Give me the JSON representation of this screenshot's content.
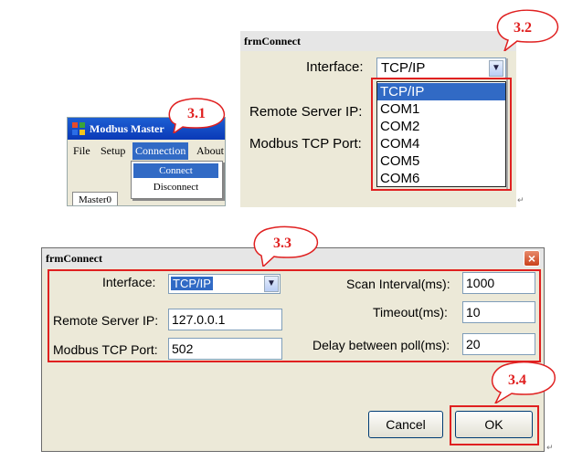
{
  "panel1": {
    "title": "Modbus Master",
    "menu": [
      "File",
      "Setup",
      "Connection",
      "About"
    ],
    "dropdown": [
      "Connect",
      "Disconnect"
    ],
    "tab": "Master0"
  },
  "panel2": {
    "title": "frmConnect",
    "interface_label": "Interface:",
    "interface_value": "TCP/IP",
    "remote_ip_label": "Remote Server IP:",
    "tcp_port_label": "Modbus TCP Port:",
    "options": [
      "TCP/IP",
      "COM1",
      "COM2",
      "COM4",
      "COM5",
      "COM6"
    ]
  },
  "panel3": {
    "title": "frmConnect",
    "interface_label": "Interface:",
    "interface_value": "TCP/IP",
    "remote_ip_label": "Remote Server IP:",
    "remote_ip_value": "127.0.0.1",
    "tcp_port_label": "Modbus TCP Port:",
    "tcp_port_value": "502",
    "scan_label": "Scan Interval(ms):",
    "scan_value": "1000",
    "timeout_label": "Timeout(ms):",
    "timeout_value": "10",
    "delay_label": "Delay between poll(ms):",
    "delay_value": "20",
    "cancel_label": "Cancel",
    "ok_label": "OK",
    "close_glyph": "×"
  },
  "callouts": {
    "c31": "3.1",
    "c32": "3.2",
    "c33": "3.3",
    "c34": "3.4"
  },
  "colors": {
    "highlight_red": "#e02020",
    "selection_blue": "#316ac5",
    "dialog_bg": "#ece9d8"
  }
}
